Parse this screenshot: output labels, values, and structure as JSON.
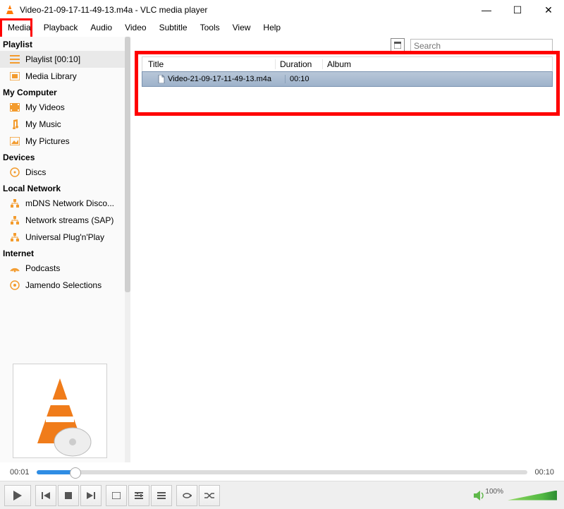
{
  "window": {
    "title": "Video-21-09-17-11-49-13.m4a - VLC media player"
  },
  "win_ctrl": {
    "min": "—",
    "max": "☐",
    "close": "✕"
  },
  "menubar": [
    "Media",
    "Playback",
    "Audio",
    "Video",
    "Subtitle",
    "Tools",
    "View",
    "Help"
  ],
  "search": {
    "placeholder": "Search"
  },
  "sidebar": {
    "sections": [
      {
        "title": "Playlist",
        "items": [
          {
            "label": "Playlist [00:10]",
            "icon": "list-icon",
            "selected": true
          },
          {
            "label": "Media Library",
            "icon": "library-icon",
            "selected": false
          }
        ]
      },
      {
        "title": "My Computer",
        "items": [
          {
            "label": "My Videos",
            "icon": "video-icon"
          },
          {
            "label": "My Music",
            "icon": "music-icon"
          },
          {
            "label": "My Pictures",
            "icon": "picture-icon"
          }
        ]
      },
      {
        "title": "Devices",
        "items": [
          {
            "label": "Discs",
            "icon": "disc-icon"
          }
        ]
      },
      {
        "title": "Local Network",
        "items": [
          {
            "label": "mDNS Network Disco...",
            "icon": "network-icon"
          },
          {
            "label": "Network streams (SAP)",
            "icon": "network-icon"
          },
          {
            "label": "Universal Plug'n'Play",
            "icon": "network-icon"
          }
        ]
      },
      {
        "title": "Internet",
        "items": [
          {
            "label": "Podcasts",
            "icon": "podcast-icon"
          },
          {
            "label": "Jamendo Selections",
            "icon": "jamendo-icon"
          }
        ]
      }
    ]
  },
  "playlist": {
    "columns": {
      "title": "Title",
      "duration": "Duration",
      "album": "Album"
    },
    "rows": [
      {
        "title": "Video-21-09-17-11-49-13.m4a",
        "duration": "00:10",
        "album": ""
      }
    ]
  },
  "playback": {
    "elapsed": "00:01",
    "total": "00:10",
    "volume_label": "100%"
  },
  "colors": {
    "highlight": "#ff0000",
    "seek_fill": "#2f8de4",
    "selected_row": "#a9bdd4"
  }
}
